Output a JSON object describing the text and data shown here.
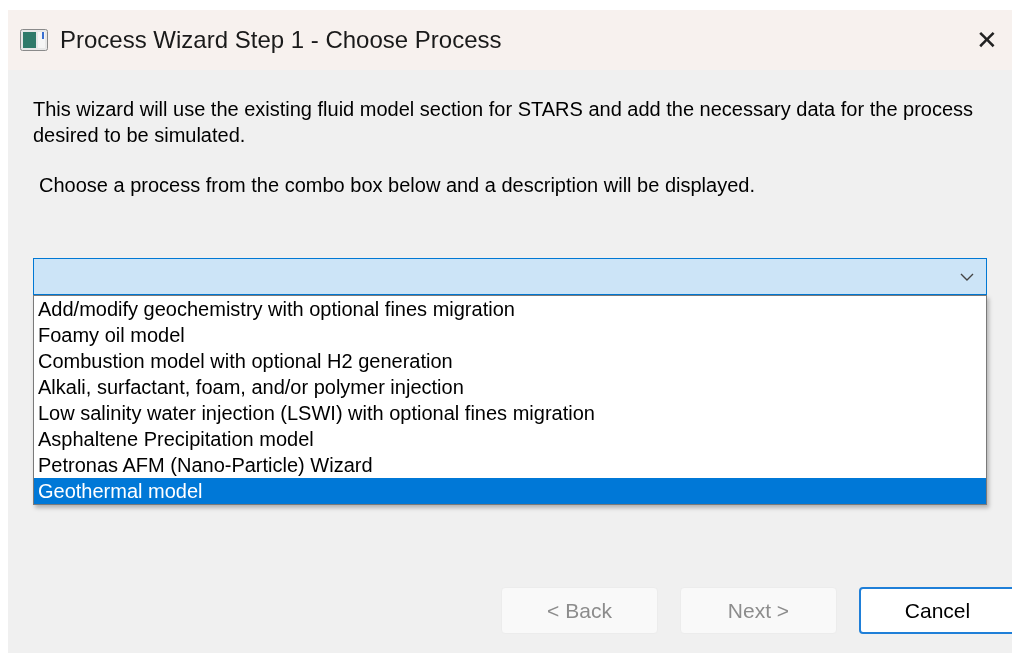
{
  "window": {
    "title": "Process Wizard Step 1 - Choose Process",
    "close": "✕"
  },
  "intro": "This wizard will use the existing fluid model section for STARS and add the necessary data for the process desired to be simulated.",
  "instruction": "Choose a process from the combo box below and a description will be displayed.",
  "combo": {
    "expanded": true,
    "options": [
      {
        "label": "Add/modify geochemistry with optional fines migration",
        "selected": false
      },
      {
        "label": "Foamy oil model",
        "selected": false
      },
      {
        "label": "Combustion model with optional H2 generation",
        "selected": false
      },
      {
        "label": "Alkali, surfactant, foam, and/or polymer injection",
        "selected": false
      },
      {
        "label": "Low salinity water injection (LSWI) with optional fines migration",
        "selected": false
      },
      {
        "label": "Asphaltene Precipitation model",
        "selected": false
      },
      {
        "label": "Petronas AFM (Nano-Particle) Wizard",
        "selected": false
      },
      {
        "label": "Geothermal model",
        "selected": true
      }
    ]
  },
  "buttons": [
    {
      "label": "< Back",
      "disabled": true,
      "default": false
    },
    {
      "label": "Next >",
      "disabled": true,
      "default": false
    },
    {
      "label": "Cancel",
      "disabled": false,
      "default": true
    }
  ]
}
